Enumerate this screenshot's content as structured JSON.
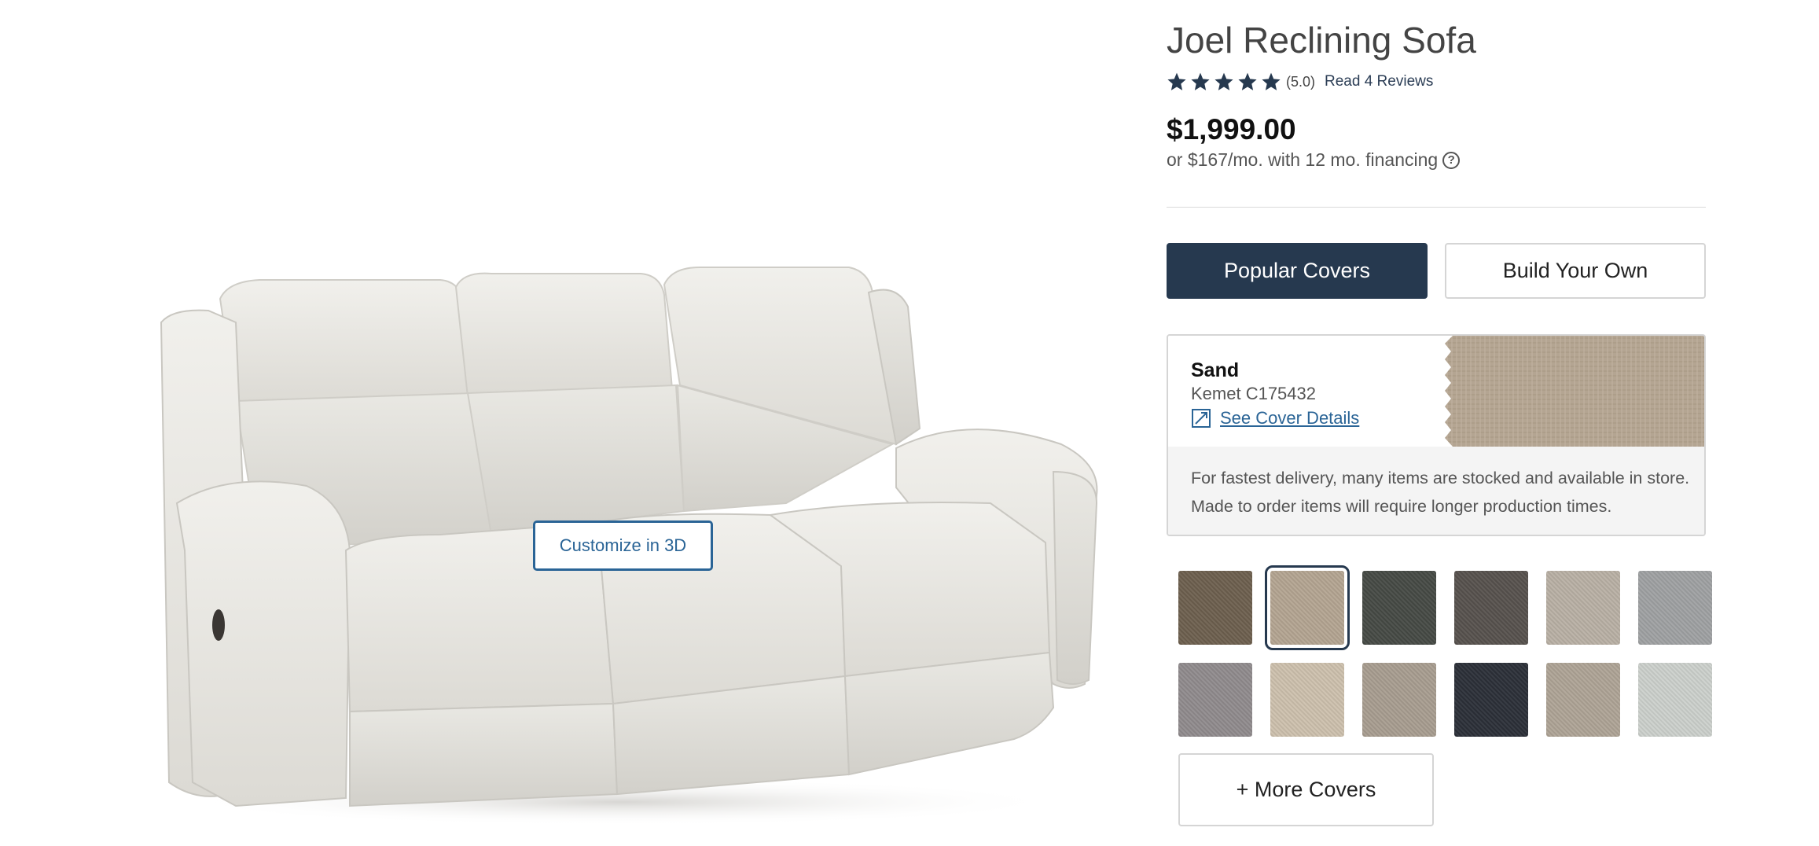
{
  "product": {
    "title": "Joel Reclining Sofa",
    "rating_value": "(5.0)",
    "stars": 5,
    "reviews_link": "Read 4 Reviews",
    "price": "$1,999.00",
    "financing": "or $167/mo. with 12 mo. financing",
    "customize_label": "Customize in 3D"
  },
  "tabs": {
    "popular": "Popular Covers",
    "build": "Build Your Own"
  },
  "selected_cover": {
    "name": "Sand",
    "code": "Kemet C175432",
    "details_link": "See Cover Details",
    "note": "For fastest delivery, many items are stocked and available in store. Made to order items will require longer production times."
  },
  "swatches": [
    {
      "color": "#6d604f",
      "selected": false
    },
    {
      "color": "#b4a592",
      "selected": true
    },
    {
      "color": "#464a45",
      "selected": false
    },
    {
      "color": "#57524e",
      "selected": false
    },
    {
      "color": "#b9b0a5",
      "selected": false
    },
    {
      "color": "#9fa1a3",
      "selected": false
    },
    {
      "color": "#908b8d",
      "selected": false
    },
    {
      "color": "#cdc0ad",
      "selected": false
    },
    {
      "color": "#a89d90",
      "selected": false
    },
    {
      "color": "#2c3038",
      "selected": false
    },
    {
      "color": "#aea496",
      "selected": false
    },
    {
      "color": "#ccd0cc",
      "selected": false
    }
  ],
  "more_covers": "+ More Covers",
  "colors": {
    "navy": "#26394f",
    "link": "#2a6496",
    "sand": "#b4a592"
  },
  "icons": {
    "star": "star-icon",
    "help": "question-circle-icon",
    "details": "external-link-icon"
  }
}
